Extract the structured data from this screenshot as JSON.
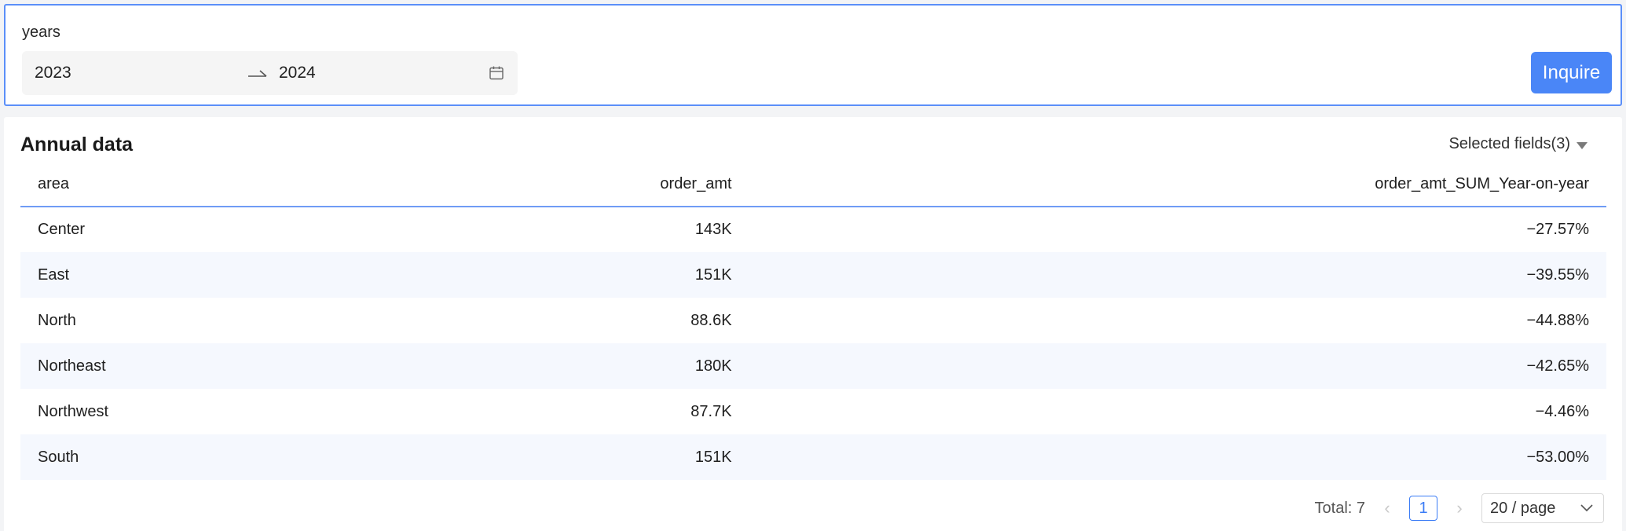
{
  "filter": {
    "label": "years",
    "start_year": "2023",
    "end_year": "2024",
    "inquire_label": "Inquire"
  },
  "panel": {
    "title": "Annual data",
    "fields_label": "Selected fields(3)"
  },
  "table": {
    "columns": [
      "area",
      "order_amt",
      "order_amt_SUM_Year-on-year"
    ],
    "rows": [
      [
        "Center",
        "143K",
        "−27.57%"
      ],
      [
        "East",
        "151K",
        "−39.55%"
      ],
      [
        "North",
        "88.6K",
        "−44.88%"
      ],
      [
        "Northeast",
        "180K",
        "−42.65%"
      ],
      [
        "Northwest",
        "87.7K",
        "−4.46%"
      ],
      [
        "South",
        "151K",
        "−53.00%"
      ]
    ]
  },
  "pagination": {
    "total_label": "Total: 7",
    "prev_symbol": "‹",
    "current_page": "1",
    "next_symbol": "›",
    "page_size_label": "20 / page"
  },
  "colors": {
    "accent": "#4a86f7",
    "row_stripe": "#f5f8fe",
    "header_rule": "#6f9cf5"
  }
}
